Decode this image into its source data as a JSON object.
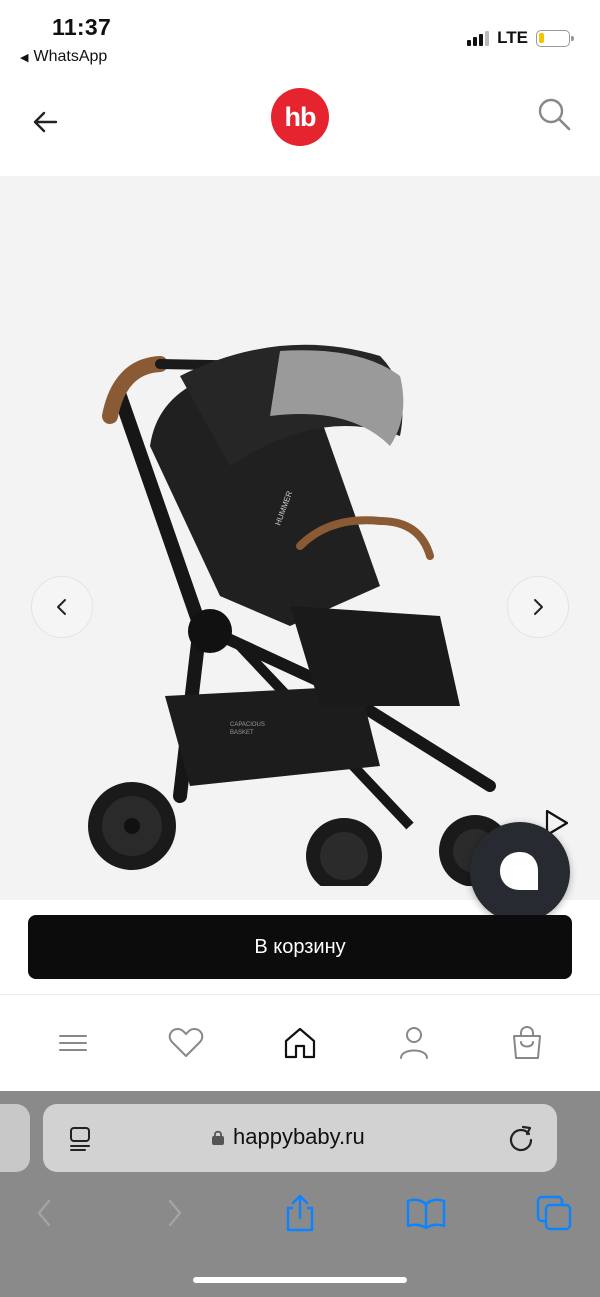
{
  "status_bar": {
    "time": "11:37",
    "back_app": "WhatsApp",
    "network": "LTE",
    "battery_level": 0.15,
    "battery_color": "#f5c400"
  },
  "header": {
    "back_icon": "arrow-left-icon",
    "logo_text": "hb",
    "logo_color": "#e5242f",
    "search_icon": "search-icon"
  },
  "gallery": {
    "product_image": "stroller-image",
    "prev_icon": "chevron-left-icon",
    "next_icon": "chevron-right-icon",
    "video_icon": "play-icon",
    "basket_label_1": "CAPACIOUS",
    "basket_label_2": "BASKET",
    "canopy_label": "HUMMER"
  },
  "chat": {
    "icon": "chat-icon",
    "color": "#272b31"
  },
  "cart": {
    "label": "В корзину"
  },
  "bottom_nav": {
    "items": [
      {
        "icon": "menu-icon"
      },
      {
        "icon": "heart-icon"
      },
      {
        "icon": "home-icon"
      },
      {
        "icon": "profile-icon"
      },
      {
        "icon": "bag-icon"
      }
    ]
  },
  "browser": {
    "url": "happybaby.ru",
    "accent_color": "#0a84ff"
  }
}
